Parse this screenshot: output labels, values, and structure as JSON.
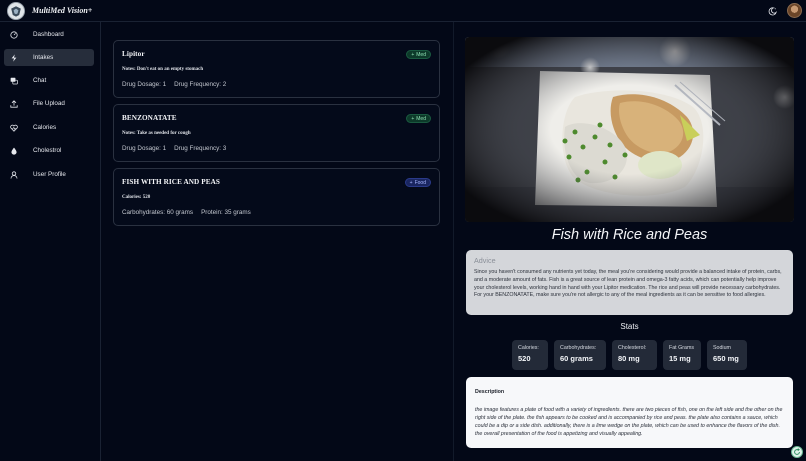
{
  "app": {
    "title": "MultiMed Vision+"
  },
  "header": {
    "theme_icon": "theme-toggle-icon",
    "avatar_icon": "user-avatar"
  },
  "sidebar": {
    "items": [
      {
        "label": "Dashboard",
        "icon": "dashboard-icon",
        "active": false
      },
      {
        "label": "Intakes",
        "icon": "bolt-icon",
        "active": true
      },
      {
        "label": "Chat",
        "icon": "chat-icon",
        "active": false
      },
      {
        "label": "File Upload",
        "icon": "upload-icon",
        "active": false
      },
      {
        "label": "Calories",
        "icon": "heart-icon",
        "active": false
      },
      {
        "label": "Cholestrol",
        "icon": "drop-icon",
        "active": false
      },
      {
        "label": "User Profile",
        "icon": "user-icon",
        "active": false
      }
    ]
  },
  "intakes": [
    {
      "title": "Lipitor",
      "badge": "Med",
      "note": "Notes: Don't eat on an empty stomach",
      "stat1": "Drug Dosage: 1",
      "stat2": "Drug Frequency: 2"
    },
    {
      "title": "BENZONATATE",
      "badge": "Med",
      "note": "Notes: Take as needed for cough",
      "stat1": "Drug Dosage: 1",
      "stat2": "Drug Frequency: 3"
    },
    {
      "title": "FISH WITH RICE AND PEAS",
      "badge": "Food",
      "note": "Calories: 520",
      "stat1": "Carbohydrates: 60 grams",
      "stat2": "Protein: 35 grams"
    }
  ],
  "detail": {
    "title": "Fish with Rice and Peas",
    "advice_heading": "Advice",
    "advice_text": "Since you haven't consumed any nutrients yet today, the meal you're considering would provide a balanced intake of protein, carbs, and a moderate amount of fats. Fish is a great source of lean protein and omega-3 fatty acids, which can potentially help improve your cholesterol levels, working hand in hand with your Lipitor medication. The rice and peas will provide necessary carbohydrates. For your BENZONATATE, make sure you're not allergic to any of the meal ingredients as it can be sensitive to food allergies.",
    "stats_heading": "Stats",
    "stats": [
      {
        "label": "Calories:",
        "value": "520"
      },
      {
        "label": "Carbohydrates:",
        "value": "60 grams"
      },
      {
        "label": "Cholesterol:",
        "value": "80 mg"
      },
      {
        "label": "Fat Grams",
        "value": "15 mg"
      },
      {
        "label": "Sodium",
        "value": "650 mg"
      }
    ],
    "description_heading": "Description",
    "description_text": "the image features a plate of food with a variety of ingredients. there are two pieces of fish, one on the left side and the other on the right side of the plate. the fish appears to be cooked and is accompanied by rice and peas. the plate also contains a sauce, which could be a dip or a side dish. additionally, there is a lime wedge on the plate, which can be used to enhance the flavors of the dish. the overall presentation of the food is appetizing and visually appealing."
  },
  "colors": {
    "background": "#030817",
    "active_nav": "#262d3b",
    "med_badge": "#8fe0b4",
    "food_badge": "#a6b6ff"
  }
}
